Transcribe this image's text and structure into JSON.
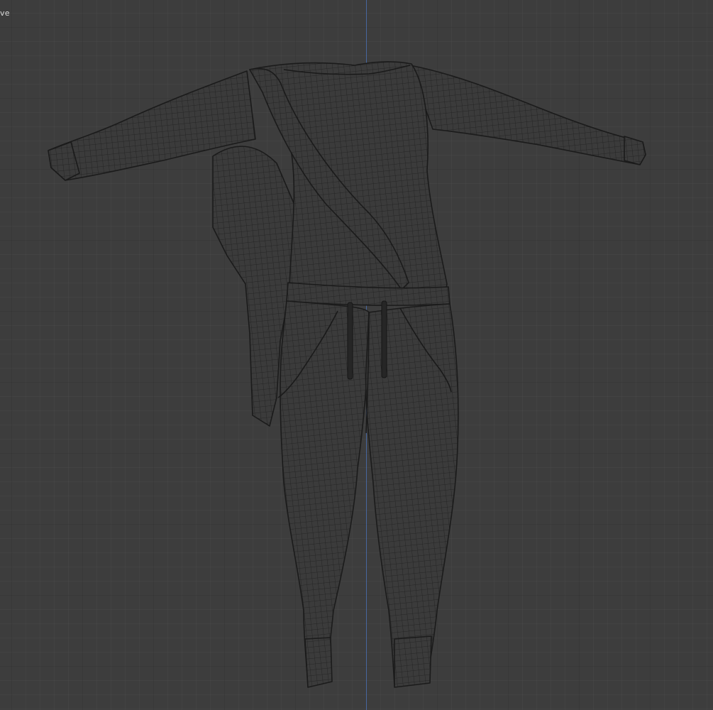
{
  "viewport": {
    "mode_text": "ve",
    "background_color": "#3d3d3d",
    "grid_color": "#303030",
    "axis_color": "#4a6fb0",
    "mesh_fill_color": "#3a3a3a",
    "wire_color": "#1b1b1b"
  },
  "scene": {
    "object": "clothing-mesh",
    "display": "wireframe",
    "pieces": [
      "shirt-torso",
      "left-sleeve",
      "right-sleeve",
      "sash",
      "draped-cloth",
      "pants-left-leg",
      "pants-right-leg",
      "waistband",
      "drawstrings",
      "cuffs"
    ]
  }
}
